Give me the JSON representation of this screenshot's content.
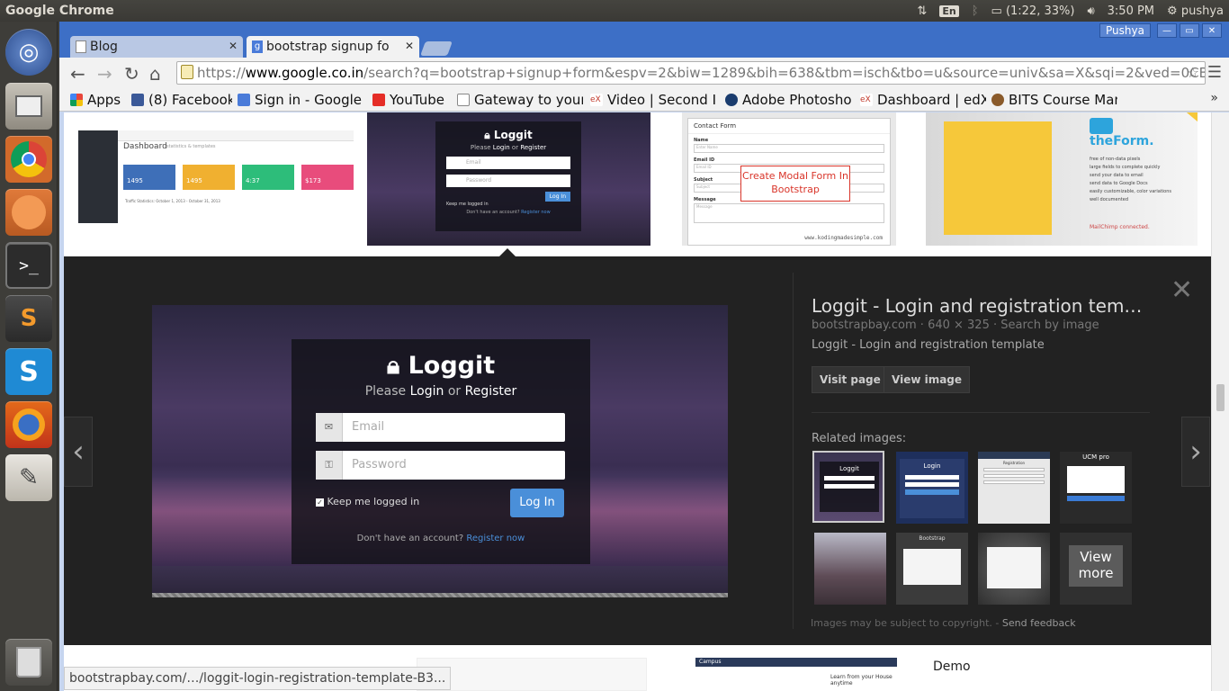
{
  "top_panel": {
    "app_title": "Google Chrome",
    "keyboard": "En",
    "battery": "(1:22, 33%)",
    "clock": "3:50 PM",
    "user": "pushya"
  },
  "launcher": {
    "items": [
      "ubuntu-dash",
      "files",
      "chrome",
      "clementine",
      "terminal",
      "sublime-text",
      "skype",
      "firefox",
      "text-editor",
      "trash"
    ]
  },
  "browser": {
    "tabs": [
      {
        "label": "Blog",
        "active": false
      },
      {
        "label": "bootstrap signup fo",
        "active": true
      }
    ],
    "profile_name": "Pushya",
    "url_prefix": "https://",
    "url_host": "www.google.co.in",
    "url_rest": "/search?q=bootstrap+signup+form&espv=2&biw=1289&bih=638&tbm=isch&tbo=u&source=univ&sa=X&sqi=2&ved=0CBwQsAR",
    "bookmarks": [
      {
        "label": "Apps",
        "color": "#e8453c"
      },
      {
        "label": "(8) Facebook",
        "color": "#3b5998"
      },
      {
        "label": "Sign in - Google A",
        "color": "#4a7bd9"
      },
      {
        "label": "YouTube",
        "color": "#e52d27"
      },
      {
        "label": "Gateway to your v",
        "color": "#ffffff"
      },
      {
        "label": "Video | Second In",
        "color": "#c0392b"
      },
      {
        "label": "Adobe Photoshop",
        "color": "#1a3c6e"
      },
      {
        "label": "Dashboard | edX",
        "color": "#c0392b"
      },
      {
        "label": "BITS Course Mana",
        "color": "#8a5a2a"
      }
    ],
    "bookmarks_more": "»"
  },
  "results": {
    "thumb_texts": {
      "dashboard_title": "Dashboard",
      "dashboard_sub": "statistics & templates",
      "dashboard_stats": [
        "1495",
        "1495",
        "4:37",
        "$173"
      ],
      "dashboard_footer": "Traffic Statistics: October 1, 2013 - October 31, 2013",
      "modal_title": "Contact Form",
      "modal_fields": [
        "Name",
        "Email ID",
        "Subject",
        "Message"
      ],
      "modal_placeholders": [
        "Enter Name",
        "Email ID",
        "Subject",
        "Message"
      ],
      "modal_callout": "Create Modal Form In Bootstrap",
      "modal_watermark": "www.kodingmadesimple.com",
      "theform_title": "theForm.",
      "theform_lines": [
        "free of non-data pixels",
        "large fields to complete quickly",
        "send your data to email",
        "send data to Google Docs",
        "easily customizable, color variations",
        "well documented"
      ],
      "theform_footer": "MailChimp connected.",
      "bottom_demo": "Demo",
      "bottom_campus": "Campus",
      "bottom_campus_text": "Learn from your House anytime"
    }
  },
  "detail_panel": {
    "title": "Loggit - Login and registration templ…",
    "source": "bootstrapbay.com",
    "dimensions": "640 × 325",
    "search_by_image": "Search by image",
    "description": "Loggit - Login and registration template",
    "visit_page": "Visit page",
    "view_image": "View image",
    "related_label": "Related images:",
    "view_more": "View more",
    "copyright": "Images may be subject to copyright.",
    "send_feedback": "Send feedback",
    "preview": {
      "brand": "Loggit",
      "tagline_pre": "Please",
      "tagline_login": "Login",
      "tagline_or": "or",
      "tagline_register": "Register",
      "email_placeholder": "Email",
      "password_placeholder": "Password",
      "keep_logged": "Keep me logged in",
      "login_button": "Log In",
      "no_account": "Don't have an account?",
      "register_now": "Register now"
    },
    "related_texts": {
      "r1": "Loggit",
      "r2": "Login",
      "r3": "Registration",
      "r4": "UCM pro",
      "r6": "Bootstrap"
    }
  },
  "status_bar": {
    "url": "bootstrapbay.com/…/loggit-login-registration-template-B3..."
  }
}
